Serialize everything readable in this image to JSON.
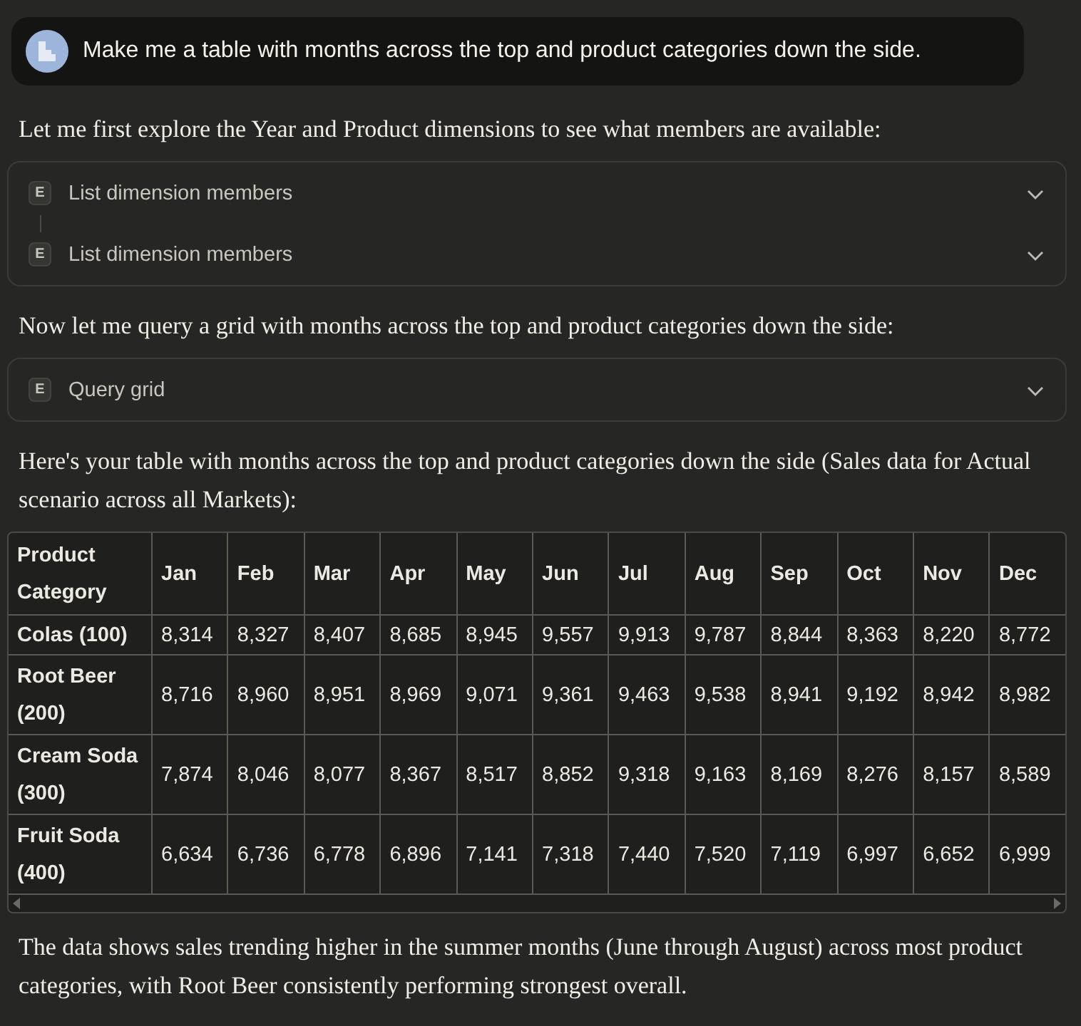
{
  "user_message": {
    "text": "Make me a table with months across the top and product categories down the side."
  },
  "messages": [
    {
      "kind": "text",
      "text": "Let me first explore the Year and Product dimensions to see what members are available:"
    },
    {
      "kind": "tools",
      "items": [
        {
          "badge": "E",
          "label": "List dimension members",
          "expanded": false
        },
        {
          "badge": "E",
          "label": "List dimension members",
          "expanded": false
        }
      ]
    },
    {
      "kind": "text",
      "text": "Now let me query a grid with months across the top and product categories down the side:"
    },
    {
      "kind": "tools",
      "items": [
        {
          "badge": "E",
          "label": "Query grid",
          "expanded": false
        }
      ]
    },
    {
      "kind": "text",
      "text": "Here's your table with months across the top and product categories down the side (Sales data for Actual scenario across all Markets):"
    },
    {
      "kind": "table",
      "columns": [
        "Product Category",
        "Jan",
        "Feb",
        "Mar",
        "Apr",
        "May",
        "Jun",
        "Jul",
        "Aug",
        "Sep",
        "Oct",
        "Nov",
        "Dec"
      ],
      "rows": [
        [
          "Colas (100)",
          "8,314",
          "8,327",
          "8,407",
          "8,685",
          "8,945",
          "9,557",
          "9,913",
          "9,787",
          "8,844",
          "8,363",
          "8,220",
          "8,772"
        ],
        [
          "Root Beer (200)",
          "8,716",
          "8,960",
          "8,951",
          "8,969",
          "9,071",
          "9,361",
          "9,463",
          "9,538",
          "8,941",
          "9,192",
          "8,942",
          "8,982"
        ],
        [
          "Cream Soda (300)",
          "7,874",
          "8,046",
          "8,077",
          "8,367",
          "8,517",
          "8,852",
          "9,318",
          "9,163",
          "8,169",
          "8,276",
          "8,157",
          "8,589"
        ],
        [
          "Fruit Soda (400)",
          "6,634",
          "6,736",
          "6,778",
          "6,896",
          "7,141",
          "7,318",
          "7,440",
          "7,520",
          "7,119",
          "6,997",
          "6,652",
          "6,999"
        ]
      ]
    },
    {
      "kind": "text",
      "text": "The data shows sales trending higher in the summer months (June through August) across most product categories, with Root Beer consistently performing strongest overall."
    }
  ]
}
